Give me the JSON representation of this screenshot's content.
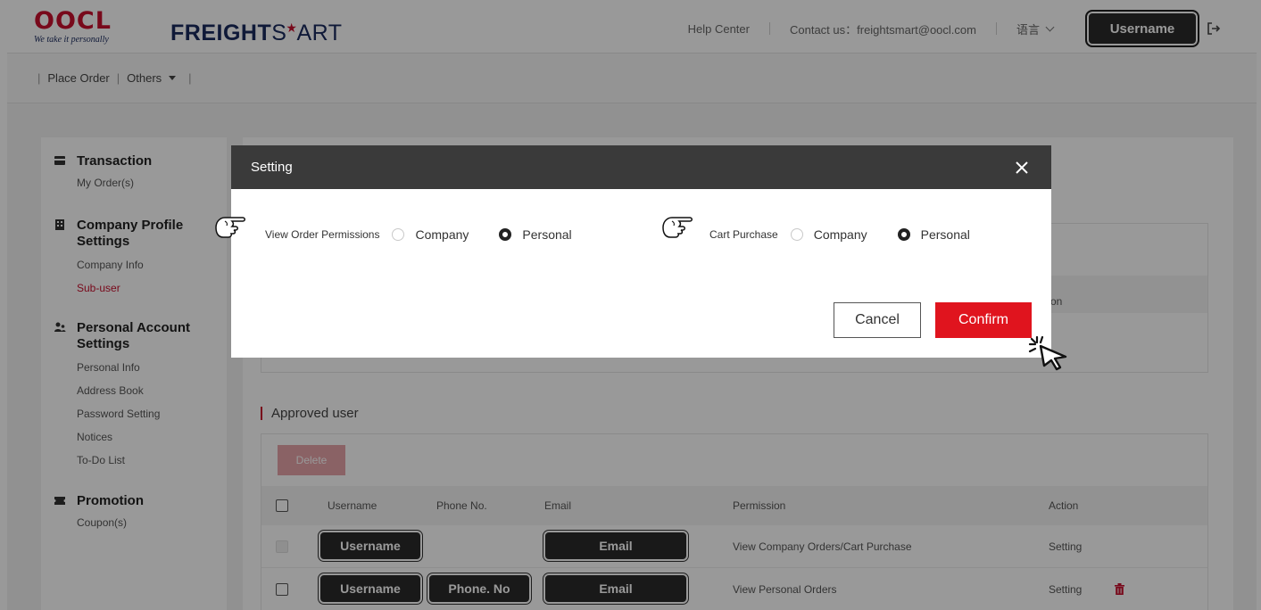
{
  "header": {
    "oocl_logo": "OOCL",
    "oocl_tagline": "We take it personally",
    "fs_logo_a": "FREIGHT",
    "fs_logo_s": "S",
    "fs_logo_b": "ART",
    "help_center": "Help Center",
    "contact": "Contact us：freightsmart@oocl.com",
    "language": "语言",
    "username": "Username"
  },
  "nav": {
    "place_order": "Place Order",
    "others": "Others"
  },
  "sidebar": {
    "transaction": {
      "title": "Transaction",
      "items": [
        "My Order(s)"
      ]
    },
    "company": {
      "title_1": "Company Profile",
      "title_2": "Settings",
      "items": [
        "Company Info",
        "Sub-user"
      ]
    },
    "personal": {
      "title_1": "Personal Account",
      "title_2": "Settings",
      "items": [
        "Personal Info",
        "Address Book",
        "Password Setting",
        "Notices",
        "To-Do List"
      ]
    },
    "promotion": {
      "title": "Promotion",
      "items": [
        "Coupon(s)"
      ]
    }
  },
  "main": {
    "action_partial": "tion",
    "approved_title": "Approved user",
    "delete_label": "Delete",
    "columns": {
      "username": "Username",
      "phone": "Phone No.",
      "email": "Email",
      "permission": "Permission",
      "action": "Action"
    },
    "rows": [
      {
        "username": "Username",
        "phone": "",
        "email": "Email",
        "permission": "View Company Orders/Cart Purchase",
        "action": "Setting"
      },
      {
        "username": "Username",
        "phone": "Phone. No",
        "email": "Email",
        "permission": "View Personal Orders",
        "action": "Setting"
      }
    ]
  },
  "modal": {
    "title": "Setting",
    "view_order_label": "View Order Permissions",
    "cart_label": "Cart Purchase",
    "option_company": "Company",
    "option_personal": "Personal",
    "view_order_selected": "Personal",
    "cart_selected": "Personal",
    "cancel": "Cancel",
    "confirm": "Confirm"
  },
  "colors": {
    "brand_red": "#c8102e",
    "confirm_red": "#e0141e",
    "modal_header": "#3a3a3a"
  }
}
